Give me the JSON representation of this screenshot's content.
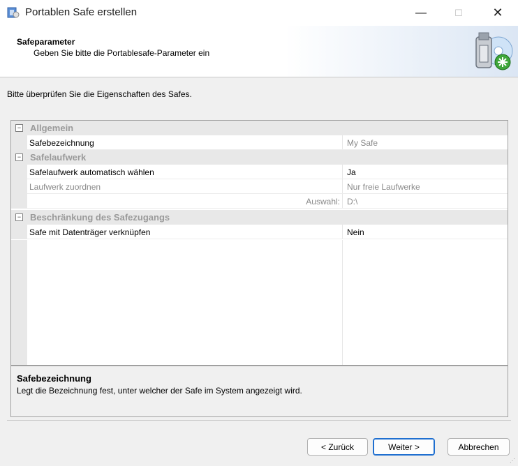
{
  "window": {
    "title": "Portablen Safe erstellen",
    "minimize": "—",
    "maximize": "☐",
    "close": "✕"
  },
  "header": {
    "title": "Safeparameter",
    "subtitle": "Geben Sie bitte die Portablesafe-Parameter ein"
  },
  "intro": "Bitte überprüfen Sie die Eigenschaften des Safes.",
  "grid": {
    "categories": [
      {
        "label": "Allgemein",
        "toggle": "⊟"
      },
      {
        "label": "Safelaufwerk",
        "toggle": "⊟"
      },
      {
        "label": "Beschränkung des Safezugangs",
        "toggle": "⊟"
      }
    ],
    "properties": [
      {
        "name": "Safebezeichnung",
        "value": "My Safe"
      },
      {
        "name": "Safelaufwerk automatisch wählen",
        "value": "Ja"
      },
      {
        "name": "Laufwerk zuordnen",
        "value": "Nur freie Laufwerke"
      },
      {
        "name": "Auswahl:",
        "value": "D:\\"
      },
      {
        "name": "Safe mit Datenträger verknüpfen",
        "value": "Nein"
      }
    ]
  },
  "description": {
    "title": "Safebezeichnung",
    "text": "Legt die Bezeichnung fest, unter welcher der Safe im System angezeigt wird."
  },
  "buttons": {
    "back": "< Zurück",
    "next": "Weiter >",
    "cancel": "Abbrechen"
  },
  "colors": {
    "accent": "#1f6fd0",
    "category_text": "#9a9a9a",
    "disabled_text": "#8a8a8a"
  }
}
